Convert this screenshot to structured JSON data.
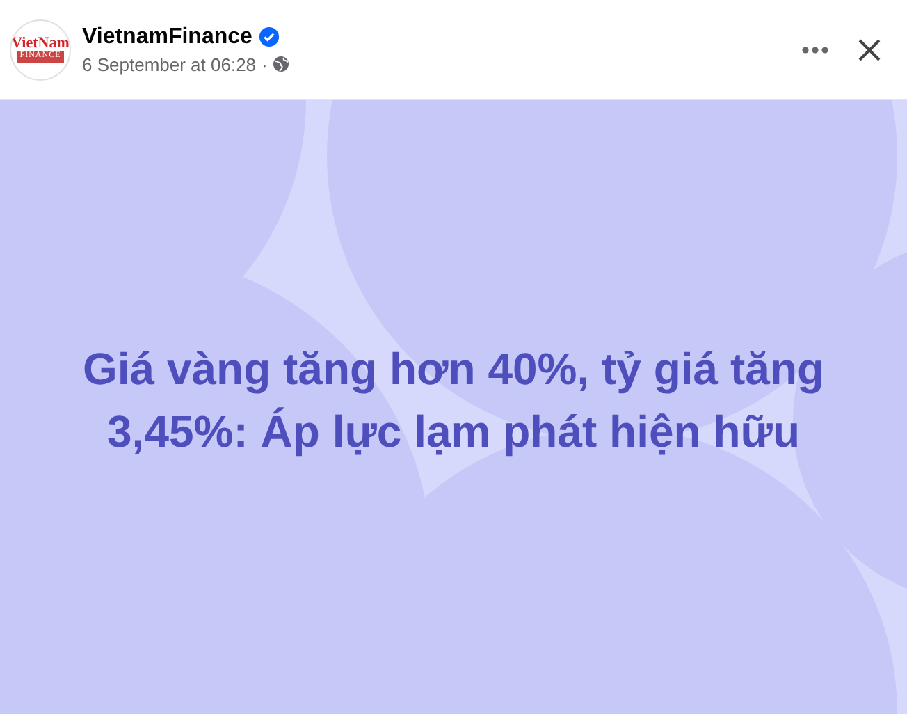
{
  "post": {
    "author": "VietnamFinance",
    "verified": true,
    "logo": {
      "line_1": "VietNam",
      "line_2": "FINANCE"
    },
    "timestamp": "6 September at 06:28",
    "separator": "·",
    "public": true
  },
  "content": {
    "text": "Giá vàng tăng hơn 40%, tỷ giá tăng 3,45%: Áp lực lạm phát hiện hữu"
  }
}
